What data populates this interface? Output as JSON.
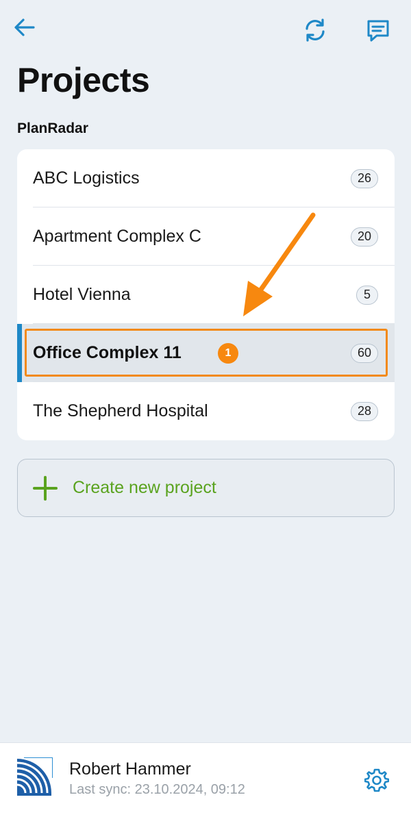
{
  "header": {
    "back_icon": "arrow-left-icon",
    "sync_icon": "refresh-icon",
    "chat_icon": "message-icon",
    "accent_color": "#1e88c7"
  },
  "page_title": "Projects",
  "section_label": "PlanRadar",
  "projects": [
    {
      "name": "ABC Logistics",
      "count": "26"
    },
    {
      "name": "Apartment Complex C",
      "count": "20"
    },
    {
      "name": "Hotel Vienna",
      "count": "5"
    },
    {
      "name": "Office Complex 11",
      "count": "60",
      "selected": true
    },
    {
      "name": "The Shepherd Hospital",
      "count": "28"
    }
  ],
  "annotation": {
    "step_number": "1",
    "color": "#f28a17"
  },
  "create_button": {
    "label": "Create new project",
    "icon": "plus-icon",
    "color": "#5aa31f"
  },
  "footer": {
    "user_name": "Robert Hammer",
    "last_sync": "Last sync: 23.10.2024, 09:12",
    "settings_icon": "gear-icon"
  }
}
